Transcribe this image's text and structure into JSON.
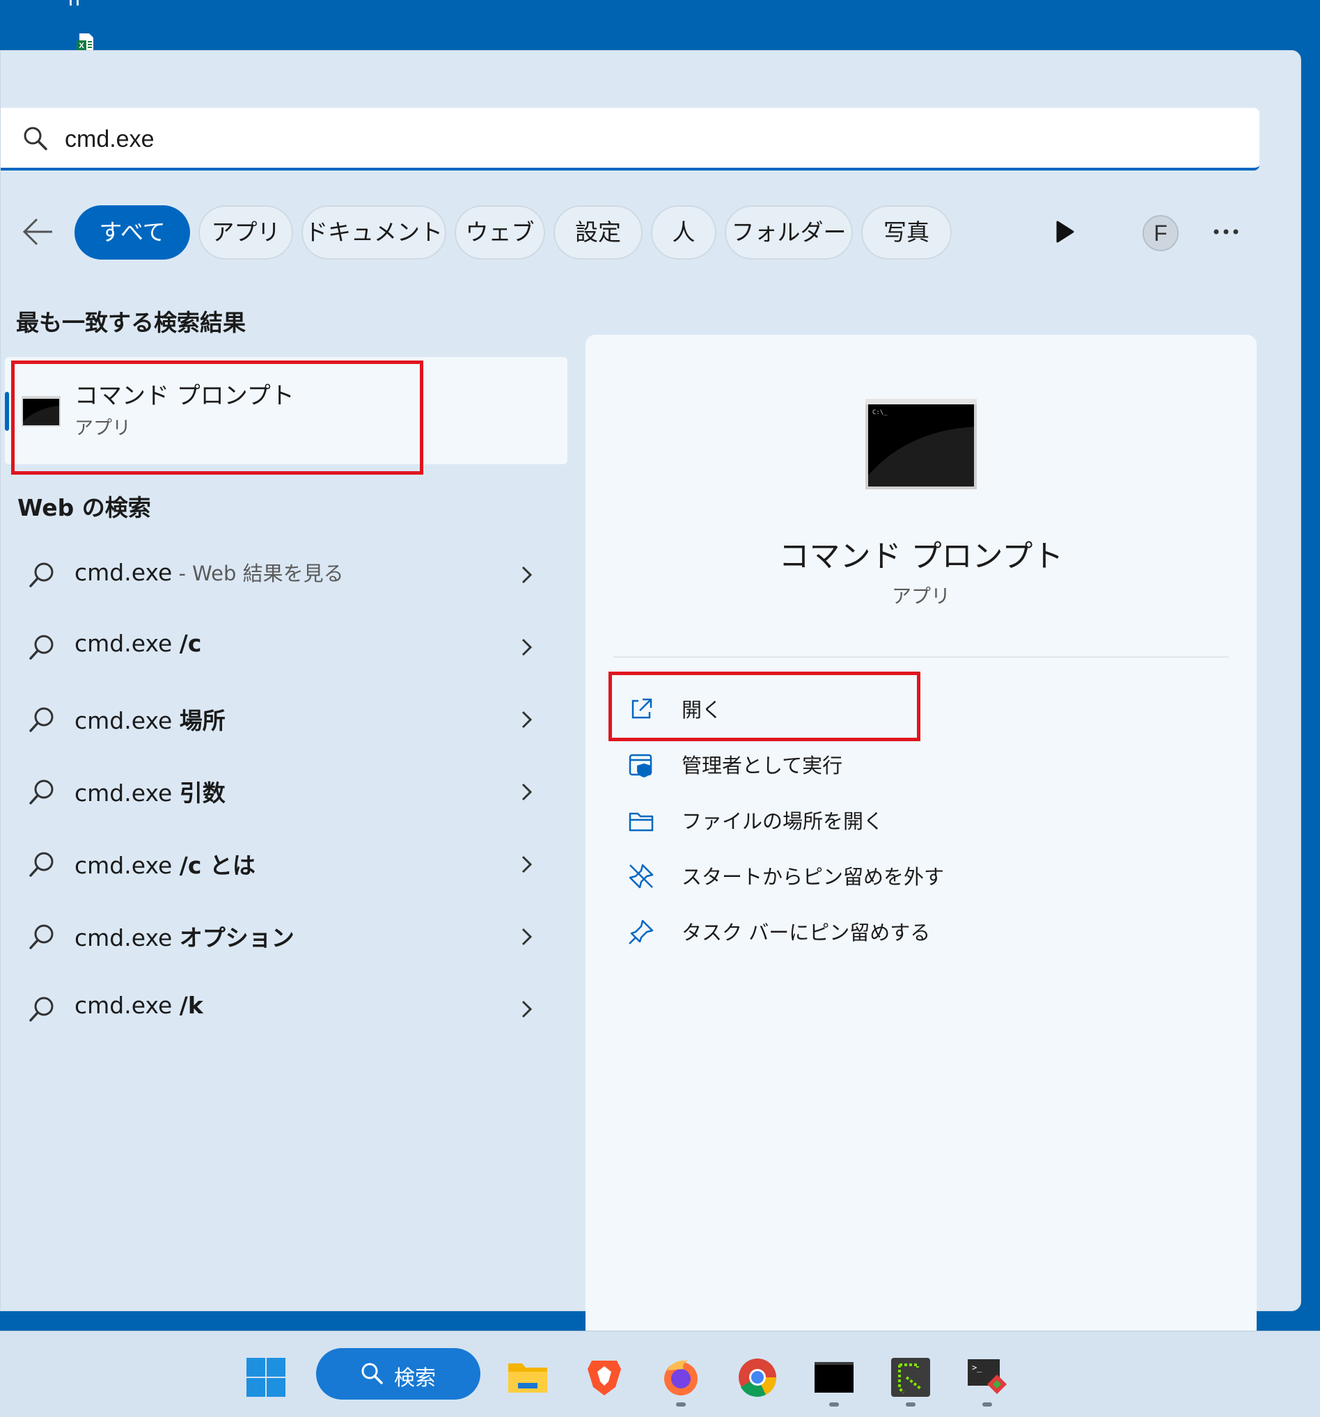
{
  "search": {
    "query": "cmd.exe"
  },
  "filters": [
    "すべて",
    "アプリ",
    "ドキュメント",
    "ウェブ",
    "設定",
    "人",
    "フォルダー",
    "写真"
  ],
  "user_initial": "F",
  "best_match": {
    "heading": "最も一致する検索結果",
    "title": "コマンド プロンプト",
    "subtitle": "アプリ"
  },
  "web_search": {
    "heading": "Web の検索",
    "items": [
      {
        "prefix": "cmd.exe",
        "bold": "",
        "suffix": " - Web 結果を見る"
      },
      {
        "prefix": "cmd.exe ",
        "bold": "/c",
        "suffix": ""
      },
      {
        "prefix": "cmd.exe ",
        "bold": "場所",
        "suffix": ""
      },
      {
        "prefix": "cmd.exe ",
        "bold": "引数",
        "suffix": ""
      },
      {
        "prefix": "cmd.exe ",
        "bold": "/c とは",
        "suffix": ""
      },
      {
        "prefix": "cmd.exe ",
        "bold": "オプション",
        "suffix": ""
      },
      {
        "prefix": "cmd.exe ",
        "bold": "/k",
        "suffix": ""
      }
    ]
  },
  "right_pane": {
    "title": "コマンド プロンプト",
    "subtitle": "アプリ",
    "actions": [
      "開く",
      "管理者として実行",
      "ファイルの場所を開く",
      "スタートからピン留めを外す",
      "タスク バーにピン留めする"
    ]
  },
  "taskbar": {
    "search_label": "検索"
  },
  "colors": {
    "accent": "#0067c0",
    "highlight_box": "#e0141e",
    "desktop": "#0063b1"
  }
}
